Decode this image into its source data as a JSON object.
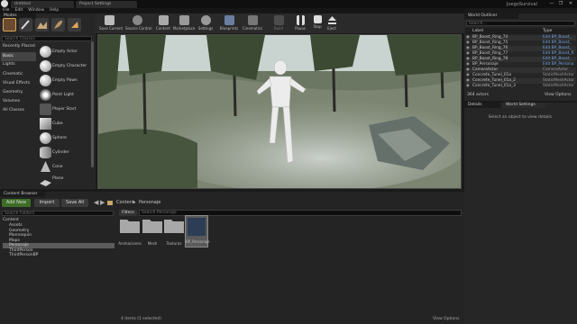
{
  "window": {
    "tabs": [
      "Untitled",
      "Project Settings"
    ],
    "project_name": "JuegoSurvival",
    "controls": [
      "—",
      "❐",
      "✕"
    ]
  },
  "menu": [
    "File",
    "Edit",
    "Window",
    "Help"
  ],
  "modes": {
    "title": "Modes",
    "search_placeholder": "Search Classes",
    "categories": [
      "Recently Placed",
      "Basic",
      "Lights",
      "Cinematic",
      "Visual Effects",
      "Geometry",
      "Volumes",
      "All Classes"
    ],
    "active_category": "Basic",
    "items": [
      "Empty Actor",
      "Empty Character",
      "Empty Pawn",
      "Point Light",
      "Player Start",
      "Cube",
      "Sphere",
      "Cylinder",
      "Cone",
      "Plane"
    ]
  },
  "toolbar": {
    "buttons": [
      "Save Current",
      "Source Control",
      "Content",
      "Marketplace",
      "Settings",
      "Blueprints",
      "Cinematics",
      "Build",
      "Pause",
      "Stop",
      "Eject"
    ]
  },
  "outliner": {
    "title": "World Outliner",
    "search_placeholder": "Search...",
    "col_label": "Label",
    "col_type": "Type",
    "rows": [
      {
        "label": "BP_Boost_Ring_74",
        "type": "Edit BP_Boost_"
      },
      {
        "label": "BP_Boost_Ring_75",
        "type": "Edit BP_Boost_"
      },
      {
        "label": "BP_Boost_Ring_76",
        "type": "Edit BP_Boost_"
      },
      {
        "label": "BP_Boost_Ring_77",
        "type": "Edit BP_Boost_R"
      },
      {
        "label": "BP_Boost_Ring_78",
        "type": "Edit BP_Boost_"
      },
      {
        "label": "BP_Personaje",
        "type": "Edit BP_Persona"
      },
      {
        "label": "CameraActor",
        "type": "CameraActor"
      },
      {
        "label": "Concrete_Tunel_01a",
        "type": "StaticMeshActor"
      },
      {
        "label": "Concrete_Tunel_01a_2",
        "type": "StaticMeshActor"
      },
      {
        "label": "Concrete_Tunel_01a_3",
        "type": "StaticMeshActor"
      }
    ],
    "count": "364 actors",
    "view_options": "View Options"
  },
  "details": {
    "tabs": [
      "Details",
      "World Settings"
    ],
    "empty_text": "Select an object to view details."
  },
  "content_browser": {
    "title": "Content Browser",
    "add_new": "Add New",
    "import": "Import",
    "save_all": "Save All",
    "breadcrumb": [
      "Content",
      "Personaje"
    ],
    "tree_search": "Search Folders",
    "filters": "Filters",
    "asset_search": "Search Personaje",
    "tree": [
      "Content",
      "Assets",
      "Geometry",
      "Mannequin",
      "Maps",
      "Personaje",
      "ThirdPerson",
      "ThirdPersonBP"
    ],
    "selected_folder": "Personaje",
    "assets": [
      "Animaciones",
      "Mesh",
      "Texturas",
      "BP_Personaje"
    ],
    "status": "4 items (1 selected)",
    "view_options": "View Options"
  }
}
